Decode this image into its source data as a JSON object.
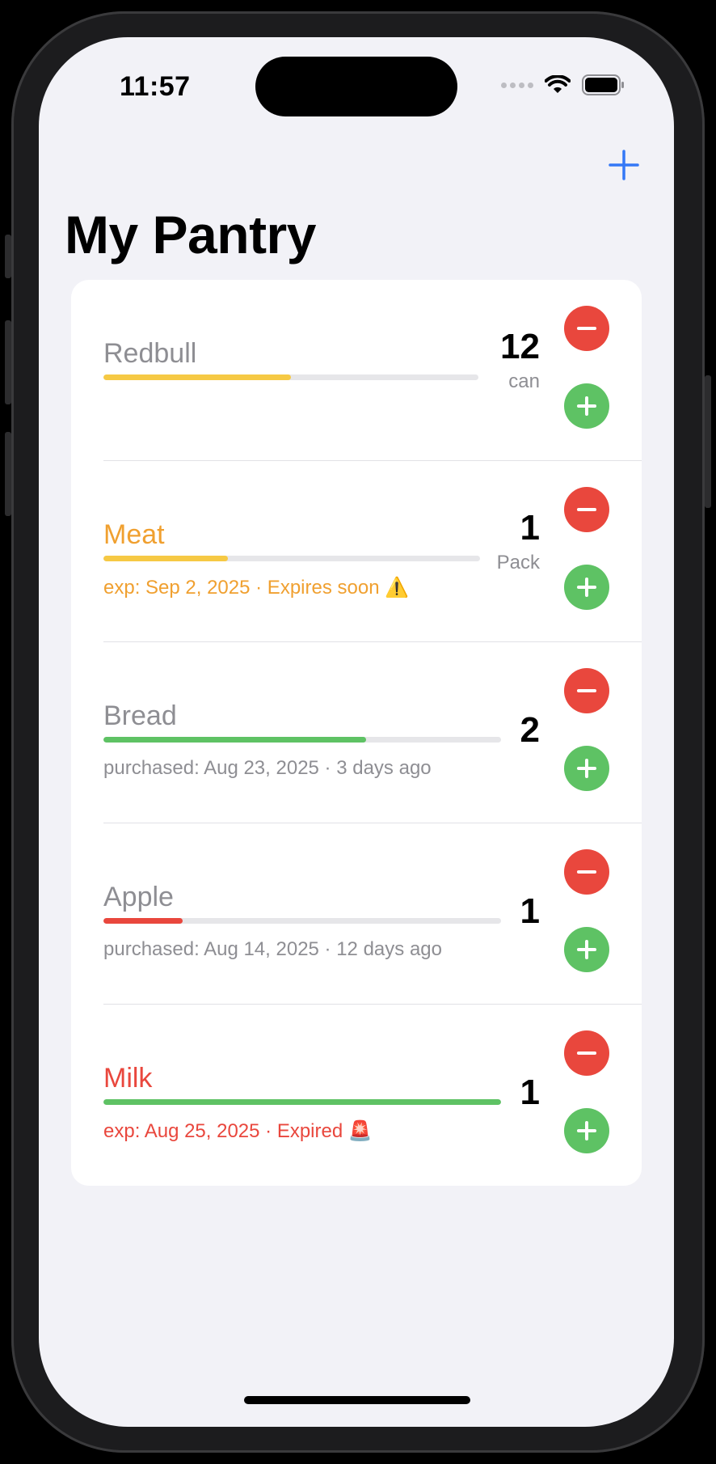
{
  "status": {
    "time": "11:57"
  },
  "header": {
    "title": "My Pantry",
    "add_icon": "plus-icon"
  },
  "colors": {
    "accent": "#3478f6",
    "yellow": "#f6c944",
    "orange": "#f0a030",
    "green": "#5ec264",
    "red": "#e9473d",
    "gray": "#8e8e93"
  },
  "items": [
    {
      "name": "Redbull",
      "quantity": "12",
      "unit": "can",
      "progress": 0.5,
      "meta": ""
    },
    {
      "name": "Meat",
      "quantity": "1",
      "unit": "Pack",
      "progress": 0.33,
      "meta": "exp: Sep 2, 2025  ·  Expires soon ⚠️"
    },
    {
      "name": "Bread",
      "quantity": "2",
      "unit": "",
      "progress": 0.66,
      "meta": "purchased: Aug 23, 2025  ·  3 days ago"
    },
    {
      "name": "Apple",
      "quantity": "1",
      "unit": "",
      "progress": 0.2,
      "meta": "purchased: Aug 14, 2025  ·  12 days ago"
    },
    {
      "name": "Milk",
      "quantity": "1",
      "unit": "",
      "progress": 1.0,
      "meta": "exp: Aug 25, 2025  ·  Expired 🚨"
    }
  ]
}
